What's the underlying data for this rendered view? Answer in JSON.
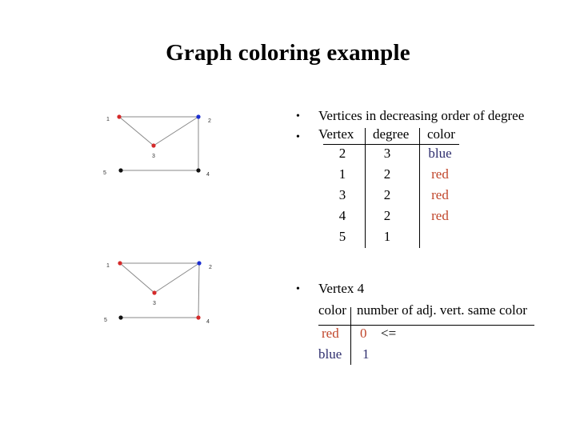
{
  "title": "Graph coloring example",
  "colors": {
    "red": "#c0452a",
    "blue": "#2e2e6e",
    "vertex_red": "#d42a2a",
    "vertex_blue": "#1c2fd0",
    "vertex_black": "#111111",
    "edge": "#888888"
  },
  "graphs": [
    {
      "name": "graph-before",
      "vertices": [
        {
          "id": "1",
          "label": "1",
          "color": "red"
        },
        {
          "id": "2",
          "label": "2",
          "color": "blue"
        },
        {
          "id": "3",
          "label": "3",
          "color": "red"
        },
        {
          "id": "4",
          "label": "4",
          "color": "black"
        },
        {
          "id": "5",
          "label": "5",
          "color": "black"
        }
      ],
      "edges": [
        [
          "1",
          "2"
        ],
        [
          "1",
          "3"
        ],
        [
          "3",
          "2"
        ],
        [
          "2",
          "4"
        ],
        [
          "5",
          "4"
        ]
      ]
    },
    {
      "name": "graph-after",
      "vertices": [
        {
          "id": "1",
          "label": "1",
          "color": "red"
        },
        {
          "id": "2",
          "label": "2",
          "color": "blue"
        },
        {
          "id": "3",
          "label": "3",
          "color": "red"
        },
        {
          "id": "4",
          "label": "4",
          "color": "red"
        },
        {
          "id": "5",
          "label": "5",
          "color": "black"
        }
      ],
      "edges": [
        [
          "1",
          "2"
        ],
        [
          "1",
          "3"
        ],
        [
          "3",
          "2"
        ],
        [
          "2",
          "4"
        ],
        [
          "5",
          "4"
        ]
      ]
    }
  ],
  "bullets": {
    "b1": "Vertices in decreasing order of degree",
    "b2_marker": "•",
    "b3": "Vertex 4"
  },
  "table1": {
    "headers": [
      "Vertex",
      "degree",
      "color"
    ],
    "rows": [
      {
        "vertex": "2",
        "degree": "3",
        "color": "blue"
      },
      {
        "vertex": "1",
        "degree": "2",
        "color": "red"
      },
      {
        "vertex": "3",
        "degree": "2",
        "color": "red"
      },
      {
        "vertex": "4",
        "degree": "2",
        "color": "red"
      },
      {
        "vertex": "5",
        "degree": "1",
        "color": ""
      }
    ]
  },
  "table2": {
    "headers": [
      "color",
      "number of adj. vert. same color"
    ],
    "rows": [
      {
        "color": "red",
        "count": "0",
        "note": "<="
      },
      {
        "color": "blue",
        "count": "1",
        "note": ""
      }
    ]
  }
}
